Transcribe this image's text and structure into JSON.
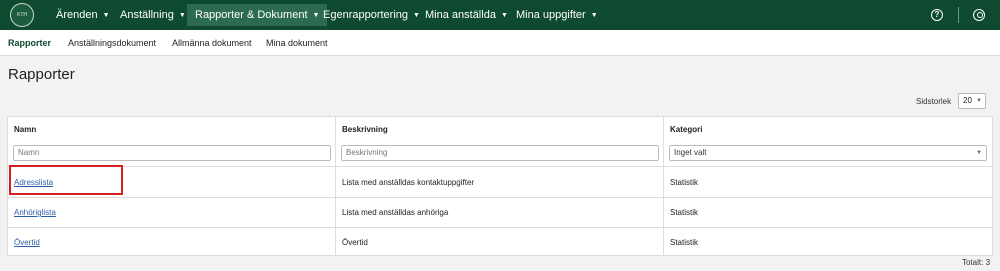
{
  "topnav": {
    "logo_text": "KTH",
    "items": [
      {
        "label": "Ärenden"
      },
      {
        "label": "Anställning"
      },
      {
        "label": "Rapporter & Dokument"
      },
      {
        "label": "Egenrapportering"
      },
      {
        "label": "Mina anställda"
      },
      {
        "label": "Mina uppgifter"
      }
    ],
    "active_index": 2,
    "help_icon": "?",
    "icons": [
      "help-icon",
      "user-icon",
      "chevron-down-icon"
    ]
  },
  "subnav": {
    "items": [
      {
        "label": "Rapporter"
      },
      {
        "label": "Anställningsdokument"
      },
      {
        "label": "Allmänna dokument"
      },
      {
        "label": "Mina dokument"
      }
    ],
    "active_index": 0
  },
  "page": {
    "title": "Rapporter",
    "page_size_label": "Sidstorlek",
    "page_size_value": "20",
    "total": "Totalt: 3"
  },
  "table": {
    "columns": [
      {
        "header": "Namn",
        "filter_placeholder": "Namn"
      },
      {
        "header": "Beskrivning",
        "filter_placeholder": "Beskrivning"
      },
      {
        "header": "Kategori",
        "filter_value": "Inget valt"
      }
    ],
    "rows": [
      {
        "name": "Adresslista",
        "description": "Lista med anställdas kontaktuppgifter",
        "category": "Statistik"
      },
      {
        "name": "Anhöriglista",
        "description": "Lista med anställdas anhöriga",
        "category": "Statistik"
      },
      {
        "name": "Övertid",
        "description": "Övertid",
        "category": "Statistik"
      }
    ]
  },
  "colors": {
    "nav_bg": "#0e4a2f",
    "nav_active": "#2d6b50",
    "link": "#2a5ea8",
    "highlight": "#d42020"
  }
}
